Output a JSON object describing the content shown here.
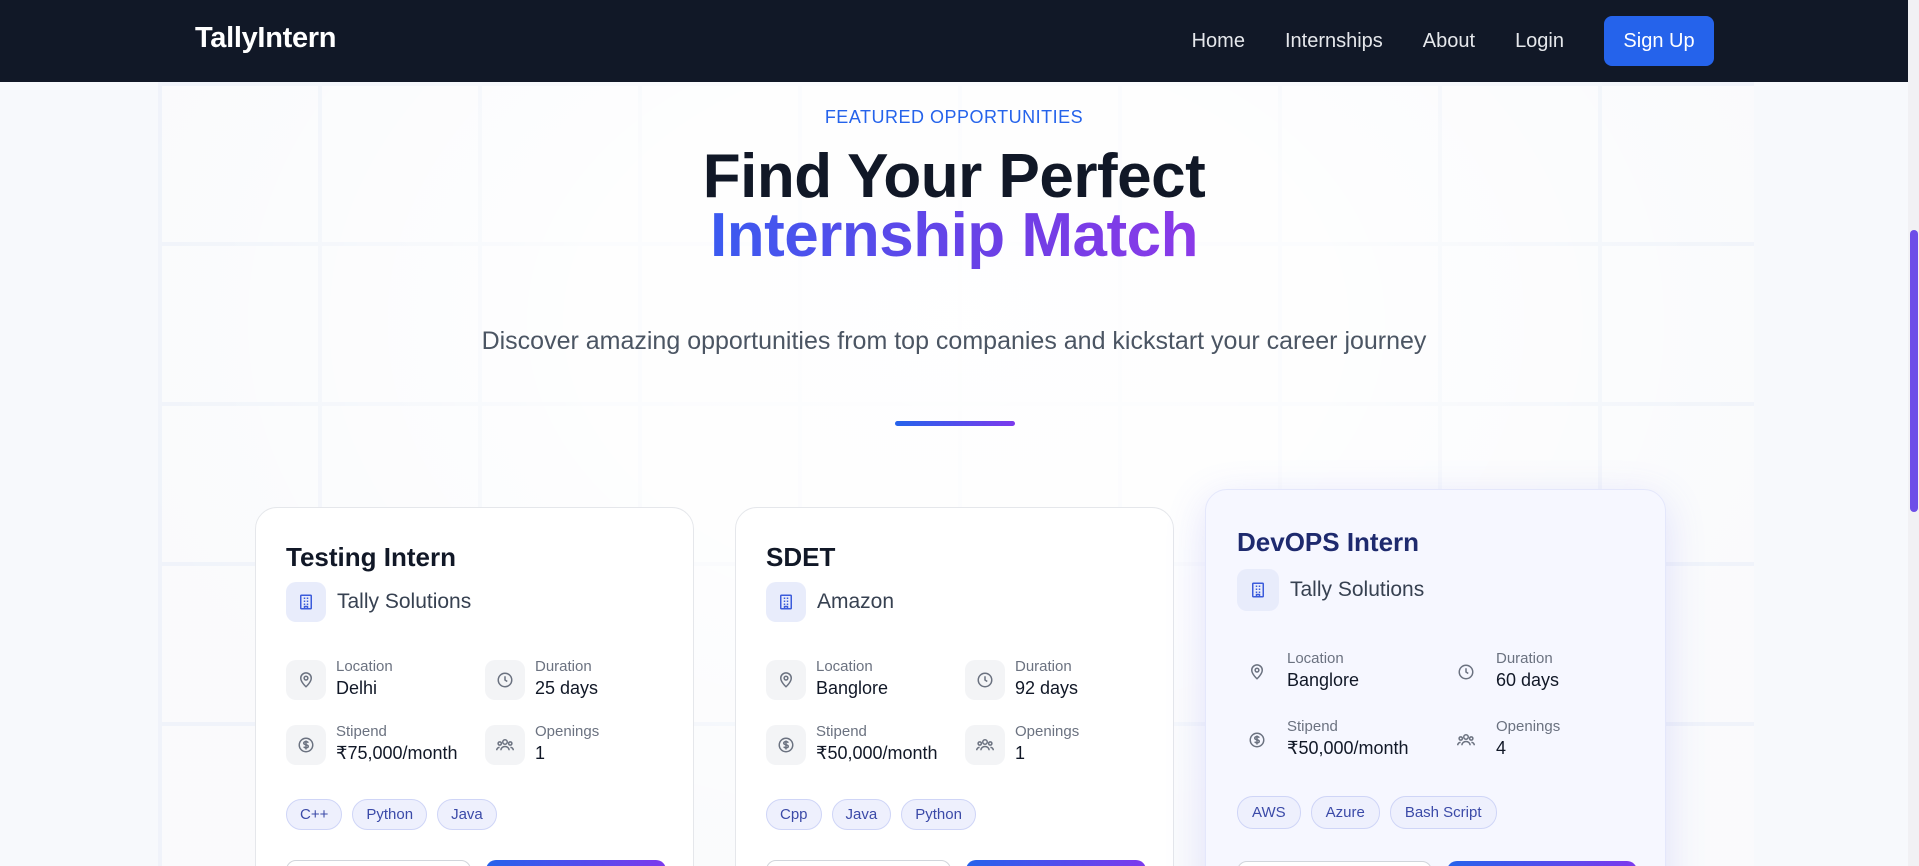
{
  "nav": {
    "brand": "TallyIntern",
    "links": [
      "Home",
      "Internships",
      "About",
      "Login"
    ],
    "signup": "Sign Up"
  },
  "hero": {
    "eyebrow": "FEATURED OPPORTUNITIES",
    "title_line1": "Find Your Perfect",
    "title_line2": "Internship Match",
    "subtitle": "Discover amazing opportunities from top companies and kickstart your career journey"
  },
  "labels": {
    "location": "Location",
    "duration": "Duration",
    "stipend": "Stipend",
    "openings": "Openings"
  },
  "cards": [
    {
      "title": "Testing Intern",
      "company": "Tally Solutions",
      "location": "Delhi",
      "duration": "25 days",
      "stipend": "₹75,000/month",
      "openings": "1",
      "tags": [
        "C++",
        "Python",
        "Java"
      ]
    },
    {
      "title": "SDET",
      "company": "Amazon",
      "location": "Banglore",
      "duration": "92 days",
      "stipend": "₹50,000/month",
      "openings": "1",
      "tags": [
        "Cpp",
        "Java",
        "Python"
      ]
    },
    {
      "title": "DevOPS Intern",
      "company": "Tally Solutions",
      "location": "Banglore",
      "duration": "60 days",
      "stipend": "₹50,000/month",
      "openings": "4",
      "tags": [
        "AWS",
        "Azure",
        "Bash Script"
      ]
    }
  ],
  "colors": {
    "nav_bg": "#111827",
    "accent": "#2563eb",
    "gradient_end": "#7c3aed"
  },
  "icons": {
    "company": "building-icon",
    "location": "map-pin-icon",
    "duration": "clock-icon",
    "stipend": "dollar-circle-icon",
    "openings": "users-icon"
  }
}
